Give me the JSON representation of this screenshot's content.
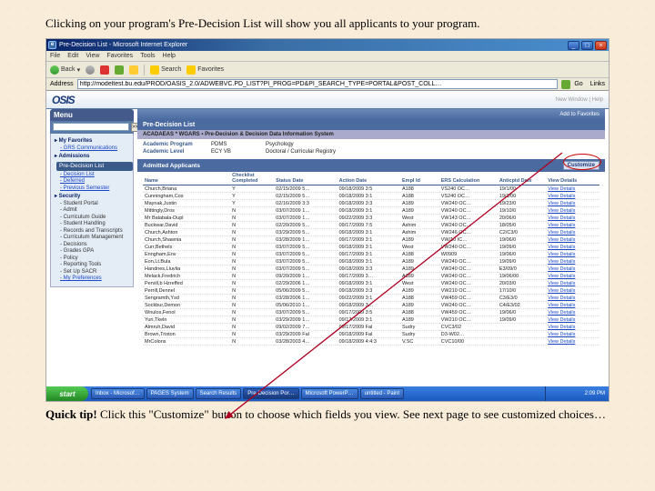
{
  "slide": {
    "top_caption": "Clicking on your program's Pre-Decision List will show you all applicants to your program.",
    "tip_label": "Quick tip!",
    "tip_text": " Click this \"Customize\" button to choose which fields you view. See next page to see customized choices…"
  },
  "ie": {
    "title": "Pre-Decision List - Microsoft Internet Explorer",
    "menus": [
      "File",
      "Edit",
      "View",
      "Favorites",
      "Tools",
      "Help"
    ],
    "back": "Back",
    "search": "Search",
    "favorites": "Favorites",
    "address_label": "Address",
    "address": "http://modeltest.bu.edu/PROD/OASIS_2.0/ADWEBVC.PD_LIST?PI_PROG=PD&PI_SEARCH_TYPE=PORTAL&POST_COLL…",
    "go": "Go",
    "links": "Links"
  },
  "banner": {
    "logo": "OSIS",
    "right": "New Window | Help"
  },
  "menu": {
    "header": "Menu",
    "search_btn": ">>",
    "items": [
      {
        "t": "cat",
        "v": "My Favorites"
      },
      {
        "t": "link",
        "v": "GRS Communications"
      },
      {
        "t": "cat",
        "v": "Admissions"
      },
      {
        "t": "sel",
        "v": "Pre-Decision List"
      },
      {
        "t": "link",
        "v": "Decision List"
      },
      {
        "t": "link",
        "v": "Deferred"
      },
      {
        "t": "link",
        "v": "Previous Semester"
      },
      {
        "t": "cat",
        "v": "Security"
      },
      {
        "t": "plain",
        "v": "Student Portal"
      },
      {
        "t": "plain",
        "v": "Admit"
      },
      {
        "t": "plain",
        "v": "Curriculum Guide"
      },
      {
        "t": "plain",
        "v": "Student Handling"
      },
      {
        "t": "plain",
        "v": "Records and Transcripts"
      },
      {
        "t": "plain",
        "v": "Curriculum Management"
      },
      {
        "t": "plain",
        "v": "Decisions"
      },
      {
        "t": "plain",
        "v": "Grades GPA"
      },
      {
        "t": "plain",
        "v": "Policy"
      },
      {
        "t": "plain",
        "v": "Reporting Tools"
      },
      {
        "t": "plain",
        "v": "Set Up SACR"
      },
      {
        "t": "link",
        "v": "My Preferences"
      }
    ]
  },
  "main": {
    "top_right": "Add to Favorites",
    "list_header": "Pre-Decision List",
    "subtitle": "ACADAEAS * WGARS • Pre-Decision & Decision Data Information System",
    "f1_lbl": "Academic Program",
    "f1_val": "PDMS",
    "f1_val2": "Psychology",
    "f2_lbl": "Academic Level",
    "f2_val": "ECY VB",
    "f2_val2": "Doctoral / Curricular Registry",
    "bar_label": "Admitted Applicants",
    "customize": "Customize",
    "columns": [
      "Name",
      "Checklist Completed",
      "Status Date",
      "Action Date",
      "Empl Id",
      "ERS Calculation",
      "Anticptd Date",
      "View Details"
    ],
    "rows": [
      [
        "Church,Briana",
        "Y",
        "02/15/2009 5…",
        "09/18/2009 3:5",
        "A188",
        "VS240 OC…",
        "19/1/00",
        "View Details"
      ],
      [
        "Cunningham,Cos",
        "Y",
        "02/15/2009 5…",
        "09/18/2009 3:1",
        "A188",
        "VS240 OC…",
        "19/1/00",
        "View Details"
      ],
      [
        "Maynak,Justin",
        "Y",
        "02/16/2009 3:3",
        "09/18/2009 3:3",
        "A189",
        "VW240 OC…",
        "19/23/0",
        "View Details"
      ],
      [
        "Mittingly,Dros",
        "N",
        "03/07/2009 1…",
        "09/18/2009 3:1",
        "A189",
        "VW240 OC…",
        "19/10/0",
        "View Details"
      ],
      [
        "Mr Balabala-Dupl",
        "N",
        "03/07/2009 1…",
        "09/22/2009 3:3",
        "West",
        "VW143 OC…",
        "20/06/0",
        "View Details"
      ],
      [
        "Buckwar,David",
        "N",
        "02/20/2009 5…",
        "09/17/2009 7:5",
        "Ashim",
        "VW240 OC…",
        "18/05/0",
        "View Details"
      ],
      [
        "Church,Ashton",
        "N",
        "03/29/2009 5…",
        "09/18/2009 3:1",
        "Ashim",
        "VW246 OC…",
        "C2/C3/0",
        "View Details"
      ],
      [
        "Church,Shawnia",
        "N",
        "03/28/2009 1…",
        "09/17/2009 3:1",
        "A189",
        "VW/10 IC…",
        "19/06/0",
        "View Details"
      ],
      [
        "Curr,Bethels",
        "N",
        "03/07/2009 5…",
        "09/18/2009 3:1",
        "West",
        "VW240 OC…",
        "19/09/0",
        "View Details"
      ],
      [
        "Enngham,Env",
        "N",
        "03/07/2009 5…",
        "09/17/2009 3:1",
        "A188",
        "W0909",
        "19/06/0",
        "View Details"
      ],
      [
        "Eon,Lt.Bula",
        "N",
        "03/07/2009 5…",
        "09/18/2009 3:1",
        "A189",
        "VW240 OC…",
        "19/09/0",
        "View Details"
      ],
      [
        "Handnes,Lluvlia",
        "N",
        "03/07/2009 5…",
        "09/18/2009 3:3",
        "A189",
        "VW240 OC…",
        "E3/09/0",
        "View Details"
      ],
      [
        "Melack,Fredrich",
        "N",
        "09/20/2009 1…",
        "09/17/2009 3…",
        "A189",
        "VW240 OC…",
        "19/06/00",
        "View Details"
      ],
      [
        "Pervill,b Hzreffed",
        "N",
        "02/29/2006 1…",
        "09/18/2009 3:1",
        "West",
        "VW240 OC…",
        "20/03/0",
        "View Details"
      ],
      [
        "Perrill,Dennel",
        "N",
        "05/06/2009 5…",
        "09/18/2009 3:3",
        "A189",
        "VW210 OC…",
        "17/10/0",
        "View Details"
      ],
      [
        "Sengramth,Ysd",
        "N",
        "03/28/2006 1…",
        "09/22/2009 3:1",
        "A188",
        "VW459 OC…",
        "C3/E3/0",
        "View Details"
      ],
      [
        "Sockbur,Demon",
        "N",
        "05/06/2010 1…",
        "09/18/2009 3…",
        "A189",
        "VW240 OC…",
        "C4/E3/02",
        "View Details"
      ],
      [
        "Wnulos,Fenol",
        "N",
        "03/07/2009 5…",
        "09/17/2009 3:5",
        "A188",
        "VW459 OC…",
        "19/06/0",
        "View Details"
      ],
      [
        "Yuri,Tkeln",
        "N",
        "03/29/2009 1…",
        "09/17/2009 3:1",
        "A189",
        "VW210 OC…",
        "19/09/0",
        "View Details"
      ],
      [
        "Almruh,David",
        "N",
        "09/02/2009 7…",
        "09/17/2009 Fal",
        "Sudry",
        "CVC3/02",
        "",
        "View Details"
      ],
      [
        "Brown,Triston",
        "N",
        "03/29/2009 Fal",
        "09/18/2009 Fal",
        "Sudry",
        "D3-W02…",
        "",
        "View Details"
      ],
      [
        "MrColons",
        "N",
        "03/28/2003 4…",
        "09/18/2009 4:4:3",
        "V,SC",
        "CVC10/00",
        "",
        "View Details"
      ]
    ]
  },
  "taskbar": {
    "start": "start",
    "buttons": [
      "Inbox - Microsof…",
      "PAGES System",
      "Search Results",
      "Pre-Decision Por…",
      "Microsoft PowerP…",
      "untitled - Paint"
    ],
    "time": "2:09 PM"
  }
}
